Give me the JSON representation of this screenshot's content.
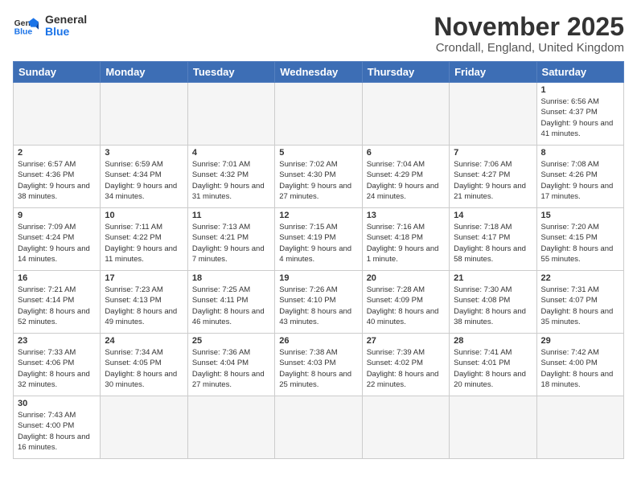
{
  "header": {
    "logo_general": "General",
    "logo_blue": "Blue",
    "month": "November 2025",
    "location": "Crondall, England, United Kingdom"
  },
  "weekdays": [
    "Sunday",
    "Monday",
    "Tuesday",
    "Wednesday",
    "Thursday",
    "Friday",
    "Saturday"
  ],
  "weeks": [
    [
      {
        "day": "",
        "info": ""
      },
      {
        "day": "",
        "info": ""
      },
      {
        "day": "",
        "info": ""
      },
      {
        "day": "",
        "info": ""
      },
      {
        "day": "",
        "info": ""
      },
      {
        "day": "",
        "info": ""
      },
      {
        "day": "1",
        "info": "Sunrise: 6:56 AM\nSunset: 4:37 PM\nDaylight: 9 hours\nand 41 minutes."
      }
    ],
    [
      {
        "day": "2",
        "info": "Sunrise: 6:57 AM\nSunset: 4:36 PM\nDaylight: 9 hours\nand 38 minutes."
      },
      {
        "day": "3",
        "info": "Sunrise: 6:59 AM\nSunset: 4:34 PM\nDaylight: 9 hours\nand 34 minutes."
      },
      {
        "day": "4",
        "info": "Sunrise: 7:01 AM\nSunset: 4:32 PM\nDaylight: 9 hours\nand 31 minutes."
      },
      {
        "day": "5",
        "info": "Sunrise: 7:02 AM\nSunset: 4:30 PM\nDaylight: 9 hours\nand 27 minutes."
      },
      {
        "day": "6",
        "info": "Sunrise: 7:04 AM\nSunset: 4:29 PM\nDaylight: 9 hours\nand 24 minutes."
      },
      {
        "day": "7",
        "info": "Sunrise: 7:06 AM\nSunset: 4:27 PM\nDaylight: 9 hours\nand 21 minutes."
      },
      {
        "day": "8",
        "info": "Sunrise: 7:08 AM\nSunset: 4:26 PM\nDaylight: 9 hours\nand 17 minutes."
      }
    ],
    [
      {
        "day": "9",
        "info": "Sunrise: 7:09 AM\nSunset: 4:24 PM\nDaylight: 9 hours\nand 14 minutes."
      },
      {
        "day": "10",
        "info": "Sunrise: 7:11 AM\nSunset: 4:22 PM\nDaylight: 9 hours\nand 11 minutes."
      },
      {
        "day": "11",
        "info": "Sunrise: 7:13 AM\nSunset: 4:21 PM\nDaylight: 9 hours\nand 7 minutes."
      },
      {
        "day": "12",
        "info": "Sunrise: 7:15 AM\nSunset: 4:19 PM\nDaylight: 9 hours\nand 4 minutes."
      },
      {
        "day": "13",
        "info": "Sunrise: 7:16 AM\nSunset: 4:18 PM\nDaylight: 9 hours\nand 1 minute."
      },
      {
        "day": "14",
        "info": "Sunrise: 7:18 AM\nSunset: 4:17 PM\nDaylight: 8 hours\nand 58 minutes."
      },
      {
        "day": "15",
        "info": "Sunrise: 7:20 AM\nSunset: 4:15 PM\nDaylight: 8 hours\nand 55 minutes."
      }
    ],
    [
      {
        "day": "16",
        "info": "Sunrise: 7:21 AM\nSunset: 4:14 PM\nDaylight: 8 hours\nand 52 minutes."
      },
      {
        "day": "17",
        "info": "Sunrise: 7:23 AM\nSunset: 4:13 PM\nDaylight: 8 hours\nand 49 minutes."
      },
      {
        "day": "18",
        "info": "Sunrise: 7:25 AM\nSunset: 4:11 PM\nDaylight: 8 hours\nand 46 minutes."
      },
      {
        "day": "19",
        "info": "Sunrise: 7:26 AM\nSunset: 4:10 PM\nDaylight: 8 hours\nand 43 minutes."
      },
      {
        "day": "20",
        "info": "Sunrise: 7:28 AM\nSunset: 4:09 PM\nDaylight: 8 hours\nand 40 minutes."
      },
      {
        "day": "21",
        "info": "Sunrise: 7:30 AM\nSunset: 4:08 PM\nDaylight: 8 hours\nand 38 minutes."
      },
      {
        "day": "22",
        "info": "Sunrise: 7:31 AM\nSunset: 4:07 PM\nDaylight: 8 hours\nand 35 minutes."
      }
    ],
    [
      {
        "day": "23",
        "info": "Sunrise: 7:33 AM\nSunset: 4:06 PM\nDaylight: 8 hours\nand 32 minutes."
      },
      {
        "day": "24",
        "info": "Sunrise: 7:34 AM\nSunset: 4:05 PM\nDaylight: 8 hours\nand 30 minutes."
      },
      {
        "day": "25",
        "info": "Sunrise: 7:36 AM\nSunset: 4:04 PM\nDaylight: 8 hours\nand 27 minutes."
      },
      {
        "day": "26",
        "info": "Sunrise: 7:38 AM\nSunset: 4:03 PM\nDaylight: 8 hours\nand 25 minutes."
      },
      {
        "day": "27",
        "info": "Sunrise: 7:39 AM\nSunset: 4:02 PM\nDaylight: 8 hours\nand 22 minutes."
      },
      {
        "day": "28",
        "info": "Sunrise: 7:41 AM\nSunset: 4:01 PM\nDaylight: 8 hours\nand 20 minutes."
      },
      {
        "day": "29",
        "info": "Sunrise: 7:42 AM\nSunset: 4:00 PM\nDaylight: 8 hours\nand 18 minutes."
      }
    ],
    [
      {
        "day": "30",
        "info": "Sunrise: 7:43 AM\nSunset: 4:00 PM\nDaylight: 8 hours\nand 16 minutes."
      },
      {
        "day": "",
        "info": ""
      },
      {
        "day": "",
        "info": ""
      },
      {
        "day": "",
        "info": ""
      },
      {
        "day": "",
        "info": ""
      },
      {
        "day": "",
        "info": ""
      },
      {
        "day": "",
        "info": ""
      }
    ]
  ]
}
